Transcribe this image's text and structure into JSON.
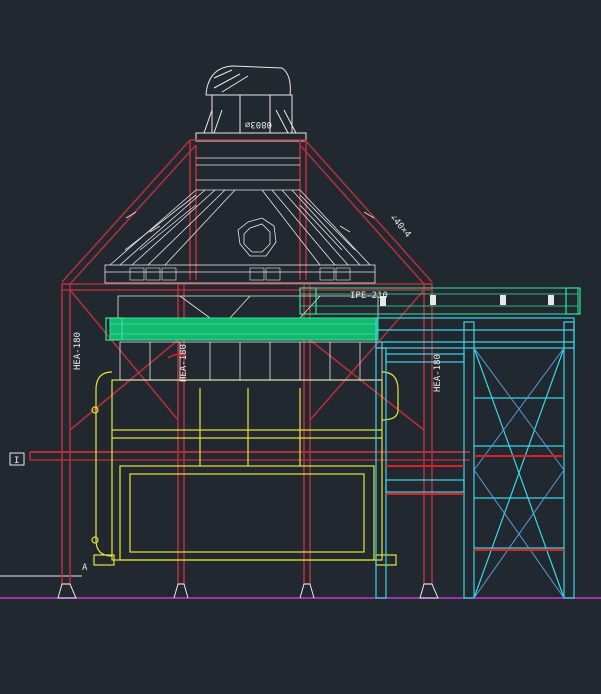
{
  "drawing": {
    "background": "#212830",
    "colors": {
      "structure": "#b0303a",
      "white": "#e8e8e8",
      "yellow": "#e6e23a",
      "green": "#2ee89a",
      "cyan": "#3ad6e6",
      "blue": "#5a9ad6",
      "magenta": "#c23ad6",
      "red": "#e02020"
    },
    "labels": {
      "top_pipe": "0803∅",
      "right_diag": "∠40×4",
      "beam_top": "IPE-210",
      "column_left": "HEA-180",
      "column_mid": "HEA-180",
      "column_right": "HEA-180",
      "section_mark": "I",
      "point_a": "A"
    }
  }
}
